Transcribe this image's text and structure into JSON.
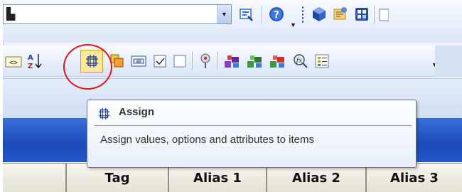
{
  "combo": {
    "value": ""
  },
  "toolbar_row1": {
    "buttons": [
      {
        "name": "save-query-icon",
        "color": "#2f6fd8"
      },
      {
        "name": "help-icon",
        "color": "#2659c9"
      },
      {
        "name": "cube-icon",
        "color": "#355fc4"
      },
      {
        "name": "open-file-icon",
        "color": "#d0a038"
      },
      {
        "name": "window-icon",
        "color": "#2a4ea8"
      }
    ]
  },
  "toolbar_row2": {
    "buttons": [
      {
        "name": "tag-brackets-icon"
      },
      {
        "name": "sort-az-icon"
      },
      {
        "name": "assign-icon",
        "highlighted": true
      },
      {
        "name": "layers-icon"
      },
      {
        "name": "field-icon"
      },
      {
        "name": "checkbox-checked-icon"
      },
      {
        "name": "checkbox-empty-icon"
      },
      {
        "name": "filter-icon"
      },
      {
        "name": "blocks-purple-icon"
      },
      {
        "name": "blocks-green-icon"
      },
      {
        "name": "blocks-red-icon"
      },
      {
        "name": "formula-search-icon"
      },
      {
        "name": "list-icon"
      }
    ]
  },
  "tooltip": {
    "title": "Assign",
    "description": "Assign values, options and attributes to items"
  },
  "grid": {
    "columns": [
      "",
      "Tag",
      "Alias 1",
      "Alias 2",
      "Alias 3"
    ]
  },
  "colors": {
    "highlight": "#e0141d",
    "header_band": "#1d4ab5"
  }
}
